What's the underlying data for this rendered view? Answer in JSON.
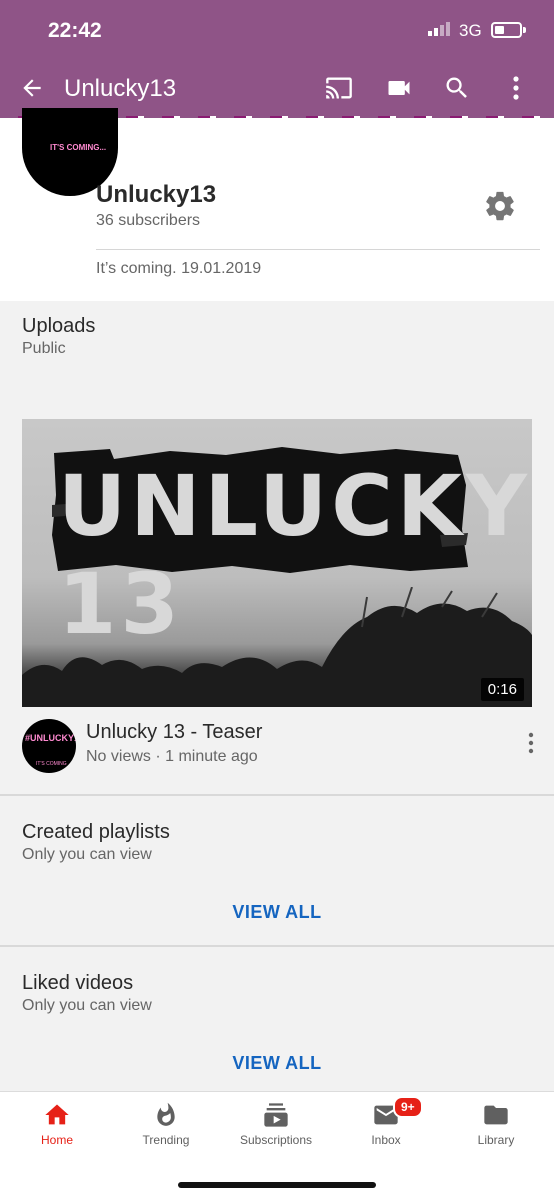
{
  "status_bar": {
    "time": "22:42",
    "network": "3G"
  },
  "app_bar": {
    "back_icon": "arrow-left-icon",
    "title": "Unlucky13",
    "icons": [
      "cast-icon",
      "video-camera-icon",
      "search-icon",
      "more-vertical-icon"
    ]
  },
  "channel": {
    "avatar_text": "IT'S COMING...",
    "name": "Unlucky13",
    "subscribers": "36 subscribers",
    "description": "It’s coming. 19.01.2019"
  },
  "uploads": {
    "title": "Uploads",
    "subtitle": "Public",
    "video": {
      "thumbnail_text": "UNLUCKY 13",
      "duration": "0:16",
      "avatar_text": "#UNLUCKY13",
      "avatar_subtext": "IT'S COMING",
      "title": "Unlucky 13 - Teaser",
      "meta": "No views · 1 minute ago"
    }
  },
  "playlists": {
    "title": "Created playlists",
    "subtitle": "Only you can view",
    "action": "VIEW ALL"
  },
  "liked": {
    "title": "Liked videos",
    "subtitle": "Only you can view",
    "action": "VIEW ALL"
  },
  "bottom_nav": {
    "items": [
      {
        "label": "Home",
        "icon": "home-icon",
        "active": true
      },
      {
        "label": "Trending",
        "icon": "flame-icon"
      },
      {
        "label": "Subscriptions",
        "icon": "subscriptions-icon"
      },
      {
        "label": "Inbox",
        "icon": "inbox-icon",
        "badge": "9+"
      },
      {
        "label": "Library",
        "icon": "folder-icon"
      }
    ]
  },
  "colors": {
    "header": "#8f5487",
    "accent_red": "#e62117",
    "link_blue": "#1565c0"
  }
}
